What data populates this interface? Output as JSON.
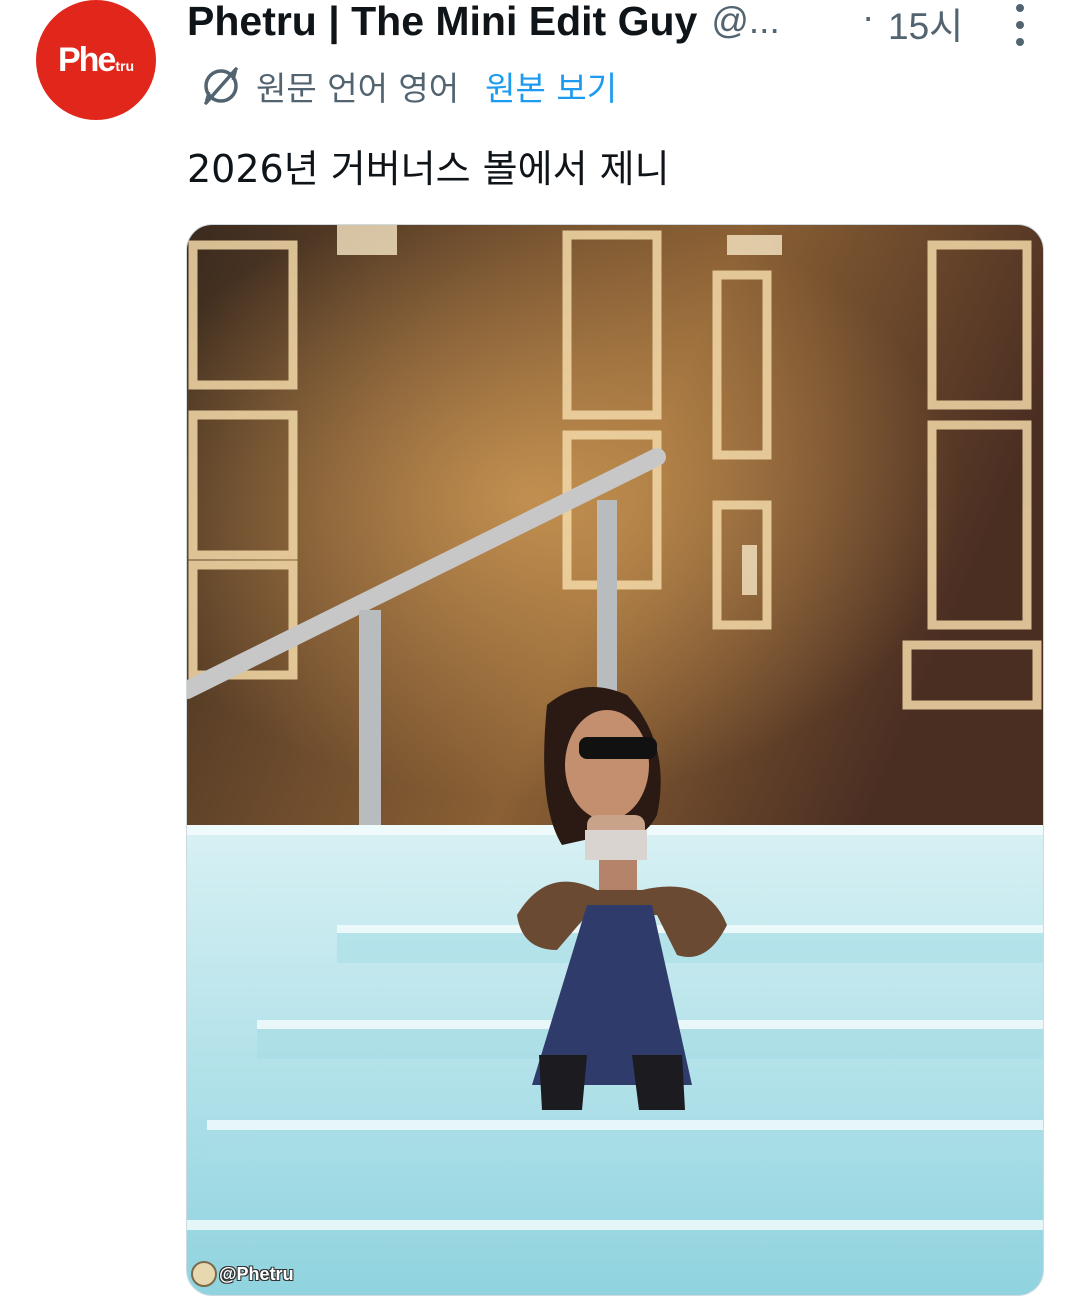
{
  "author": {
    "avatar_logo": "Phe",
    "avatar_logo_small": "tru",
    "display_name": "Phetru | The Mini Edit Guy",
    "handle": "@...",
    "separator": "·",
    "timestamp": "15시"
  },
  "translation": {
    "icon": "translate-icon",
    "label": "원문 언어 영어",
    "show_original": "원본 보기"
  },
  "tweet": {
    "text": "2026년 거버너스 볼에서 제니"
  },
  "media": {
    "watermark": "@Phetru"
  },
  "colors": {
    "avatar_bg": "#e1261c",
    "link": "#1d9bf0",
    "secondary_text": "#536471",
    "primary_text": "#0f1419"
  }
}
